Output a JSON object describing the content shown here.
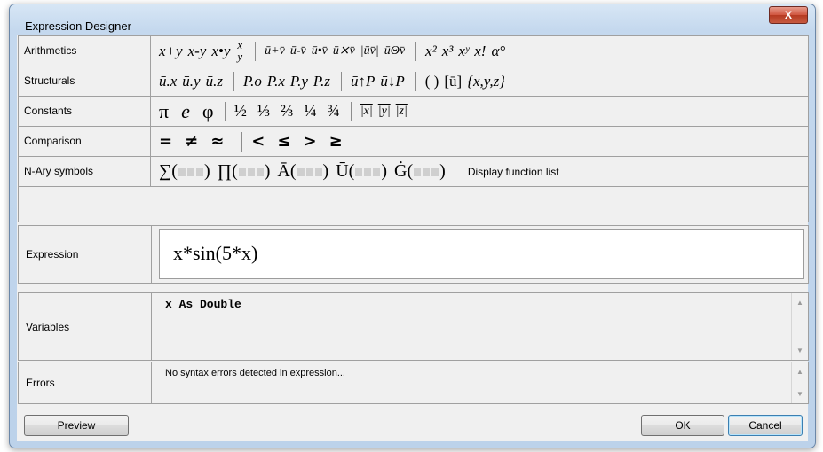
{
  "window": {
    "title": "Expression Designer",
    "close_glyph": "X"
  },
  "palette": {
    "arithmetics": {
      "label": "Arithmetics",
      "ops": [
        "x+y",
        "x-y",
        "x•y"
      ],
      "frac": {
        "num": "x",
        "den": "y"
      },
      "vec_ops": [
        "ū+v̄",
        "ū-v̄",
        "ū•v̄",
        "ū⨯v̄",
        "|ūv̄|",
        "ūΘv̄"
      ],
      "powers": [
        "x²",
        "x³",
        "xʸ",
        "x!",
        "α°"
      ]
    },
    "structurals": {
      "label": "Structurals",
      "components": [
        "ū.x",
        "ū.y",
        "ū.z"
      ],
      "point": [
        "P.o",
        "P.x",
        "P.y",
        "P.z"
      ],
      "vec_point": [
        "ū↑P",
        "ū↓P"
      ],
      "grouping": [
        "( )",
        "[ū]",
        "{x,y,z}"
      ]
    },
    "constants": {
      "label": "Constants",
      "greek": [
        "π",
        "e",
        "φ"
      ],
      "fractions": [
        "½",
        "⅓",
        "⅔",
        "¼",
        "¾"
      ],
      "unit_vectors": [
        "|x|",
        "|y|",
        "|z|"
      ]
    },
    "comparison": {
      "label": "Comparison",
      "ops": [
        "=",
        "≠",
        "≈",
        "<",
        "≤",
        ">",
        "≥"
      ]
    },
    "nary": {
      "label": "N-Ary symbols",
      "funcs": [
        "∑",
        "∏",
        "Ā",
        "Ū",
        "Ġ"
      ],
      "display_list": "Display function list"
    }
  },
  "expression": {
    "label": "Expression",
    "value": "x*sin(5*x)"
  },
  "variables": {
    "label": "Variables",
    "value": "x As Double"
  },
  "errors": {
    "label": "Errors",
    "value": "No syntax errors detected in expression..."
  },
  "buttons": {
    "preview": "Preview",
    "ok": "OK",
    "cancel": "Cancel"
  }
}
